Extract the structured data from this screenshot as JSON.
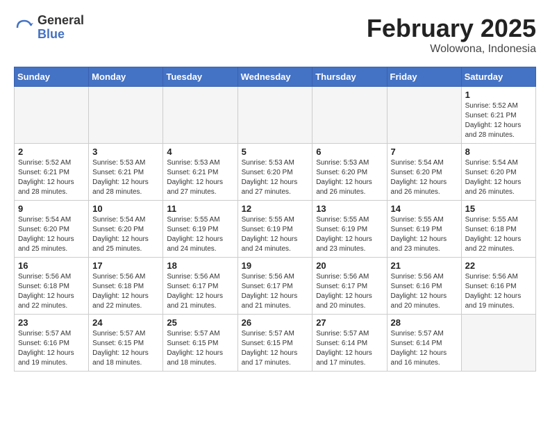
{
  "logo": {
    "general": "General",
    "blue": "Blue"
  },
  "title": {
    "month": "February 2025",
    "location": "Wolowona, Indonesia"
  },
  "headers": [
    "Sunday",
    "Monday",
    "Tuesday",
    "Wednesday",
    "Thursday",
    "Friday",
    "Saturday"
  ],
  "weeks": [
    [
      {
        "day": "",
        "info": ""
      },
      {
        "day": "",
        "info": ""
      },
      {
        "day": "",
        "info": ""
      },
      {
        "day": "",
        "info": ""
      },
      {
        "day": "",
        "info": ""
      },
      {
        "day": "",
        "info": ""
      },
      {
        "day": "1",
        "info": "Sunrise: 5:52 AM\nSunset: 6:21 PM\nDaylight: 12 hours\nand 28 minutes."
      }
    ],
    [
      {
        "day": "2",
        "info": "Sunrise: 5:52 AM\nSunset: 6:21 PM\nDaylight: 12 hours\nand 28 minutes."
      },
      {
        "day": "3",
        "info": "Sunrise: 5:53 AM\nSunset: 6:21 PM\nDaylight: 12 hours\nand 28 minutes."
      },
      {
        "day": "4",
        "info": "Sunrise: 5:53 AM\nSunset: 6:21 PM\nDaylight: 12 hours\nand 27 minutes."
      },
      {
        "day": "5",
        "info": "Sunrise: 5:53 AM\nSunset: 6:20 PM\nDaylight: 12 hours\nand 27 minutes."
      },
      {
        "day": "6",
        "info": "Sunrise: 5:53 AM\nSunset: 6:20 PM\nDaylight: 12 hours\nand 26 minutes."
      },
      {
        "day": "7",
        "info": "Sunrise: 5:54 AM\nSunset: 6:20 PM\nDaylight: 12 hours\nand 26 minutes."
      },
      {
        "day": "8",
        "info": "Sunrise: 5:54 AM\nSunset: 6:20 PM\nDaylight: 12 hours\nand 26 minutes."
      }
    ],
    [
      {
        "day": "9",
        "info": "Sunrise: 5:54 AM\nSunset: 6:20 PM\nDaylight: 12 hours\nand 25 minutes."
      },
      {
        "day": "10",
        "info": "Sunrise: 5:54 AM\nSunset: 6:20 PM\nDaylight: 12 hours\nand 25 minutes."
      },
      {
        "day": "11",
        "info": "Sunrise: 5:55 AM\nSunset: 6:19 PM\nDaylight: 12 hours\nand 24 minutes."
      },
      {
        "day": "12",
        "info": "Sunrise: 5:55 AM\nSunset: 6:19 PM\nDaylight: 12 hours\nand 24 minutes."
      },
      {
        "day": "13",
        "info": "Sunrise: 5:55 AM\nSunset: 6:19 PM\nDaylight: 12 hours\nand 23 minutes."
      },
      {
        "day": "14",
        "info": "Sunrise: 5:55 AM\nSunset: 6:19 PM\nDaylight: 12 hours\nand 23 minutes."
      },
      {
        "day": "15",
        "info": "Sunrise: 5:55 AM\nSunset: 6:18 PM\nDaylight: 12 hours\nand 22 minutes."
      }
    ],
    [
      {
        "day": "16",
        "info": "Sunrise: 5:56 AM\nSunset: 6:18 PM\nDaylight: 12 hours\nand 22 minutes."
      },
      {
        "day": "17",
        "info": "Sunrise: 5:56 AM\nSunset: 6:18 PM\nDaylight: 12 hours\nand 22 minutes."
      },
      {
        "day": "18",
        "info": "Sunrise: 5:56 AM\nSunset: 6:17 PM\nDaylight: 12 hours\nand 21 minutes."
      },
      {
        "day": "19",
        "info": "Sunrise: 5:56 AM\nSunset: 6:17 PM\nDaylight: 12 hours\nand 21 minutes."
      },
      {
        "day": "20",
        "info": "Sunrise: 5:56 AM\nSunset: 6:17 PM\nDaylight: 12 hours\nand 20 minutes."
      },
      {
        "day": "21",
        "info": "Sunrise: 5:56 AM\nSunset: 6:16 PM\nDaylight: 12 hours\nand 20 minutes."
      },
      {
        "day": "22",
        "info": "Sunrise: 5:56 AM\nSunset: 6:16 PM\nDaylight: 12 hours\nand 19 minutes."
      }
    ],
    [
      {
        "day": "23",
        "info": "Sunrise: 5:57 AM\nSunset: 6:16 PM\nDaylight: 12 hours\nand 19 minutes."
      },
      {
        "day": "24",
        "info": "Sunrise: 5:57 AM\nSunset: 6:15 PM\nDaylight: 12 hours\nand 18 minutes."
      },
      {
        "day": "25",
        "info": "Sunrise: 5:57 AM\nSunset: 6:15 PM\nDaylight: 12 hours\nand 18 minutes."
      },
      {
        "day": "26",
        "info": "Sunrise: 5:57 AM\nSunset: 6:15 PM\nDaylight: 12 hours\nand 17 minutes."
      },
      {
        "day": "27",
        "info": "Sunrise: 5:57 AM\nSunset: 6:14 PM\nDaylight: 12 hours\nand 17 minutes."
      },
      {
        "day": "28",
        "info": "Sunrise: 5:57 AM\nSunset: 6:14 PM\nDaylight: 12 hours\nand 16 minutes."
      },
      {
        "day": "",
        "info": ""
      }
    ]
  ]
}
